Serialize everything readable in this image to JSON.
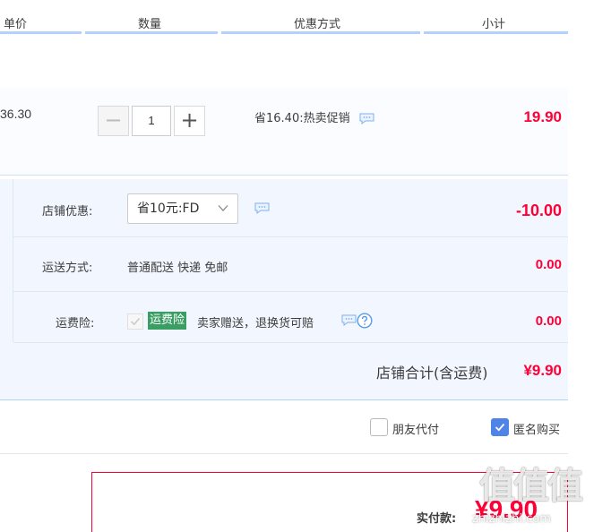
{
  "header": {
    "col_price": "单价",
    "col_qty": "数量",
    "col_promo": "优惠方式",
    "col_subtotal": "小计"
  },
  "item": {
    "price": "36.30",
    "quantity": "1",
    "minus_symbol": "−",
    "plus_symbol": "+",
    "promo_text": "省16.40:热卖促销",
    "subtotal": "19.90"
  },
  "shop": {
    "coupon_label": "店铺优惠:",
    "coupon_selected": "省10元:FD",
    "coupon_value": "-10.00",
    "shipping_label": "运送方式:",
    "shipping_text": "普通配送 快递 免邮",
    "shipping_value": "0.00",
    "insurance_label": "运费险:",
    "insurance_tag": "运费险",
    "insurance_text": "卖家赠送，退换货可赔",
    "insurance_value": "0.00",
    "total_label": "店铺合计(含运费)",
    "total_value": "¥9.90"
  },
  "options": {
    "friend_pay_label": "朋友代付",
    "friend_pay_checked": false,
    "anonymous_label": "匿名购买",
    "anonymous_checked": true
  },
  "payment": {
    "label": "实付款:",
    "value": "¥9.90"
  },
  "watermark": {
    "logo_text": "值值值",
    "site_text": "zhizhizhi.com"
  },
  "colors": {
    "accent_red": "#ff0036",
    "header_line": "#b2d1ff",
    "shop_bg": "#f2f7ff",
    "checkbox_blue": "#4f83e8",
    "insurance_green": "#3a9d64"
  }
}
